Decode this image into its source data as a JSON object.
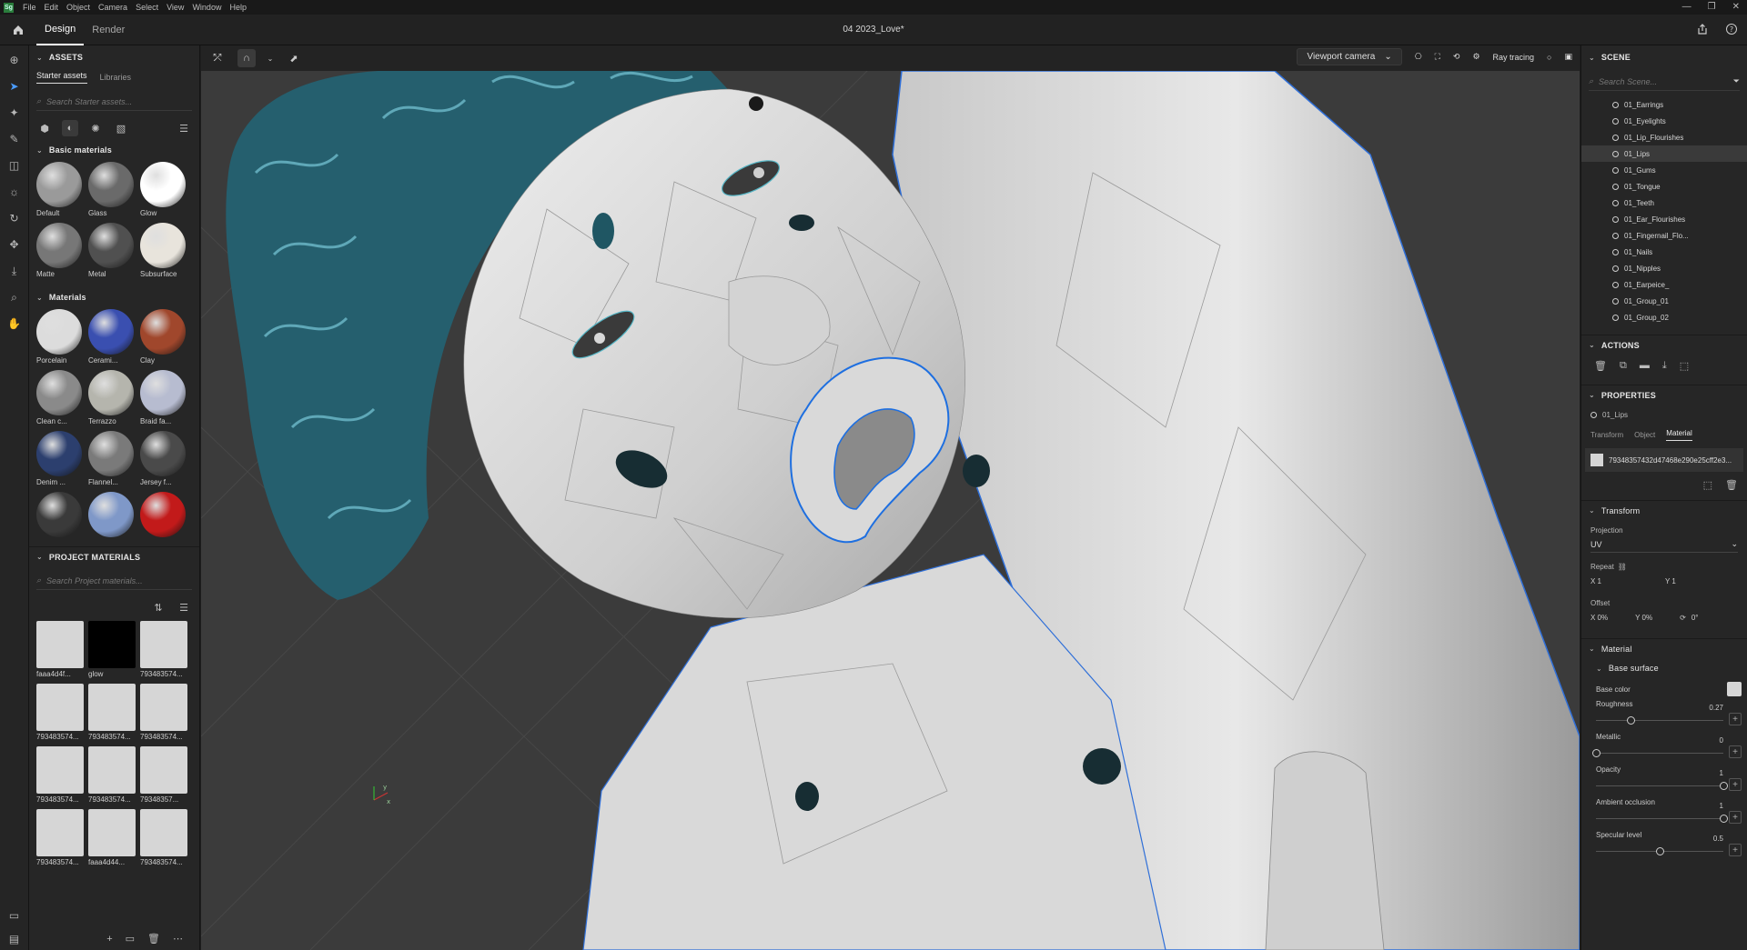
{
  "menubar": {
    "logo": "Sg",
    "items": [
      "File",
      "Edit",
      "Object",
      "Camera",
      "Select",
      "View",
      "Window",
      "Help"
    ]
  },
  "topbar": {
    "tabs": [
      "Design",
      "Render"
    ],
    "document_title": "04 2023_Love*"
  },
  "assets": {
    "header": "ASSETS",
    "tabs": [
      "Starter assets",
      "Libraries"
    ],
    "search_placeholder": "Search Starter assets...",
    "basic_header": "Basic materials",
    "basic": [
      {
        "name": "Default",
        "color": "#9a9a9a"
      },
      {
        "name": "Glass",
        "color": "#6a6a6a"
      },
      {
        "name": "Glow",
        "color": "#ffffff"
      },
      {
        "name": "Matte",
        "color": "#777777"
      },
      {
        "name": "Metal",
        "color": "#505050"
      },
      {
        "name": "Subsurface",
        "color": "#e8e4dc"
      }
    ],
    "materials_header": "Materials",
    "materials": [
      {
        "name": "Porcelain",
        "color": "#dcdcdc"
      },
      {
        "name": "Cerami...",
        "color": "#3a4fb0"
      },
      {
        "name": "Clay",
        "color": "#a0472c"
      },
      {
        "name": "Clean c...",
        "color": "#8a8a8a"
      },
      {
        "name": "Terrazzo",
        "color": "#b5b5ad"
      },
      {
        "name": "Braid fa...",
        "color": "#b7bcd0"
      },
      {
        "name": "Denim ...",
        "color": "#2c3f6e"
      },
      {
        "name": "Flannel...",
        "color": "#7a7a7a"
      },
      {
        "name": "Jersey f...",
        "color": "#4a4a4a"
      },
      {
        "name": "",
        "color": "#3a3a3a"
      },
      {
        "name": "",
        "color": "#7f98c8"
      },
      {
        "name": "",
        "color": "#c21a1a"
      }
    ],
    "project_header": "PROJECT MATERIALS",
    "project_search_placeholder": "Search Project materials...",
    "project": [
      {
        "name": "faaa4d4f...",
        "color": "#d6d6d6"
      },
      {
        "name": "glow",
        "color": "#000000"
      },
      {
        "name": "793483574...",
        "color": "#d6d6d6"
      },
      {
        "name": "793483574...",
        "color": "#d6d6d6"
      },
      {
        "name": "793483574...",
        "color": "#d6d6d6"
      },
      {
        "name": "793483574...",
        "color": "#d6d6d6"
      },
      {
        "name": "793483574...",
        "color": "#d6d6d6"
      },
      {
        "name": "793483574...",
        "color": "#d6d6d6"
      },
      {
        "name": "79348357...",
        "color": "#d6d6d6"
      },
      {
        "name": "793483574...",
        "color": "#d6d6d6"
      },
      {
        "name": "faaa4d44...",
        "color": "#d6d6d6"
      },
      {
        "name": "793483574...",
        "color": "#d6d6d6"
      }
    ]
  },
  "viewport": {
    "camera": "Viewport camera",
    "ray_tracing": "Ray tracing",
    "hair_color": "#2b6b7a",
    "accent": "#1e6fe0"
  },
  "scene": {
    "header": "SCENE",
    "search_placeholder": "Search Scene...",
    "items": [
      "01_Earrings",
      "01_Eyelights",
      "01_Lip_Flourishes",
      "01_Lips",
      "01_Gums",
      "01_Tongue",
      "01_Teeth",
      "01_Ear_Flourishes",
      "01_Fingernail_Flo...",
      "01_Nails",
      "01_Nipples",
      "01_Earpeice_",
      "01_Group_01",
      "01_Group_02"
    ],
    "selected": "01_Lips",
    "actions_header": "ACTIONS",
    "properties_header": "PROPERTIES",
    "object_name": "01_Lips",
    "prop_tabs": [
      "Transform",
      "Object",
      "Material"
    ],
    "material_name": "79348357432d47468e290e25cff2e3...",
    "transform_header": "Transform",
    "projection_label": "Projection",
    "projection_value": "UV",
    "repeat_label": "Repeat",
    "repeat_x": "X  1",
    "repeat_y": "Y  1",
    "offset_label": "Offset",
    "offset_x": "X  0%",
    "offset_y": "Y  0%",
    "rotation": "0°",
    "material_header": "Material",
    "base_surface_header": "Base surface",
    "base_color_label": "Base color",
    "props": [
      {
        "label": "Roughness",
        "value": "0.27",
        "frac": 0.27
      },
      {
        "label": "Metallic",
        "value": "0",
        "frac": 0
      },
      {
        "label": "Opacity",
        "value": "1",
        "frac": 1
      },
      {
        "label": "Ambient occlusion",
        "value": "1",
        "frac": 1
      },
      {
        "label": "Specular level",
        "value": "0.5",
        "frac": 0.5
      }
    ]
  }
}
